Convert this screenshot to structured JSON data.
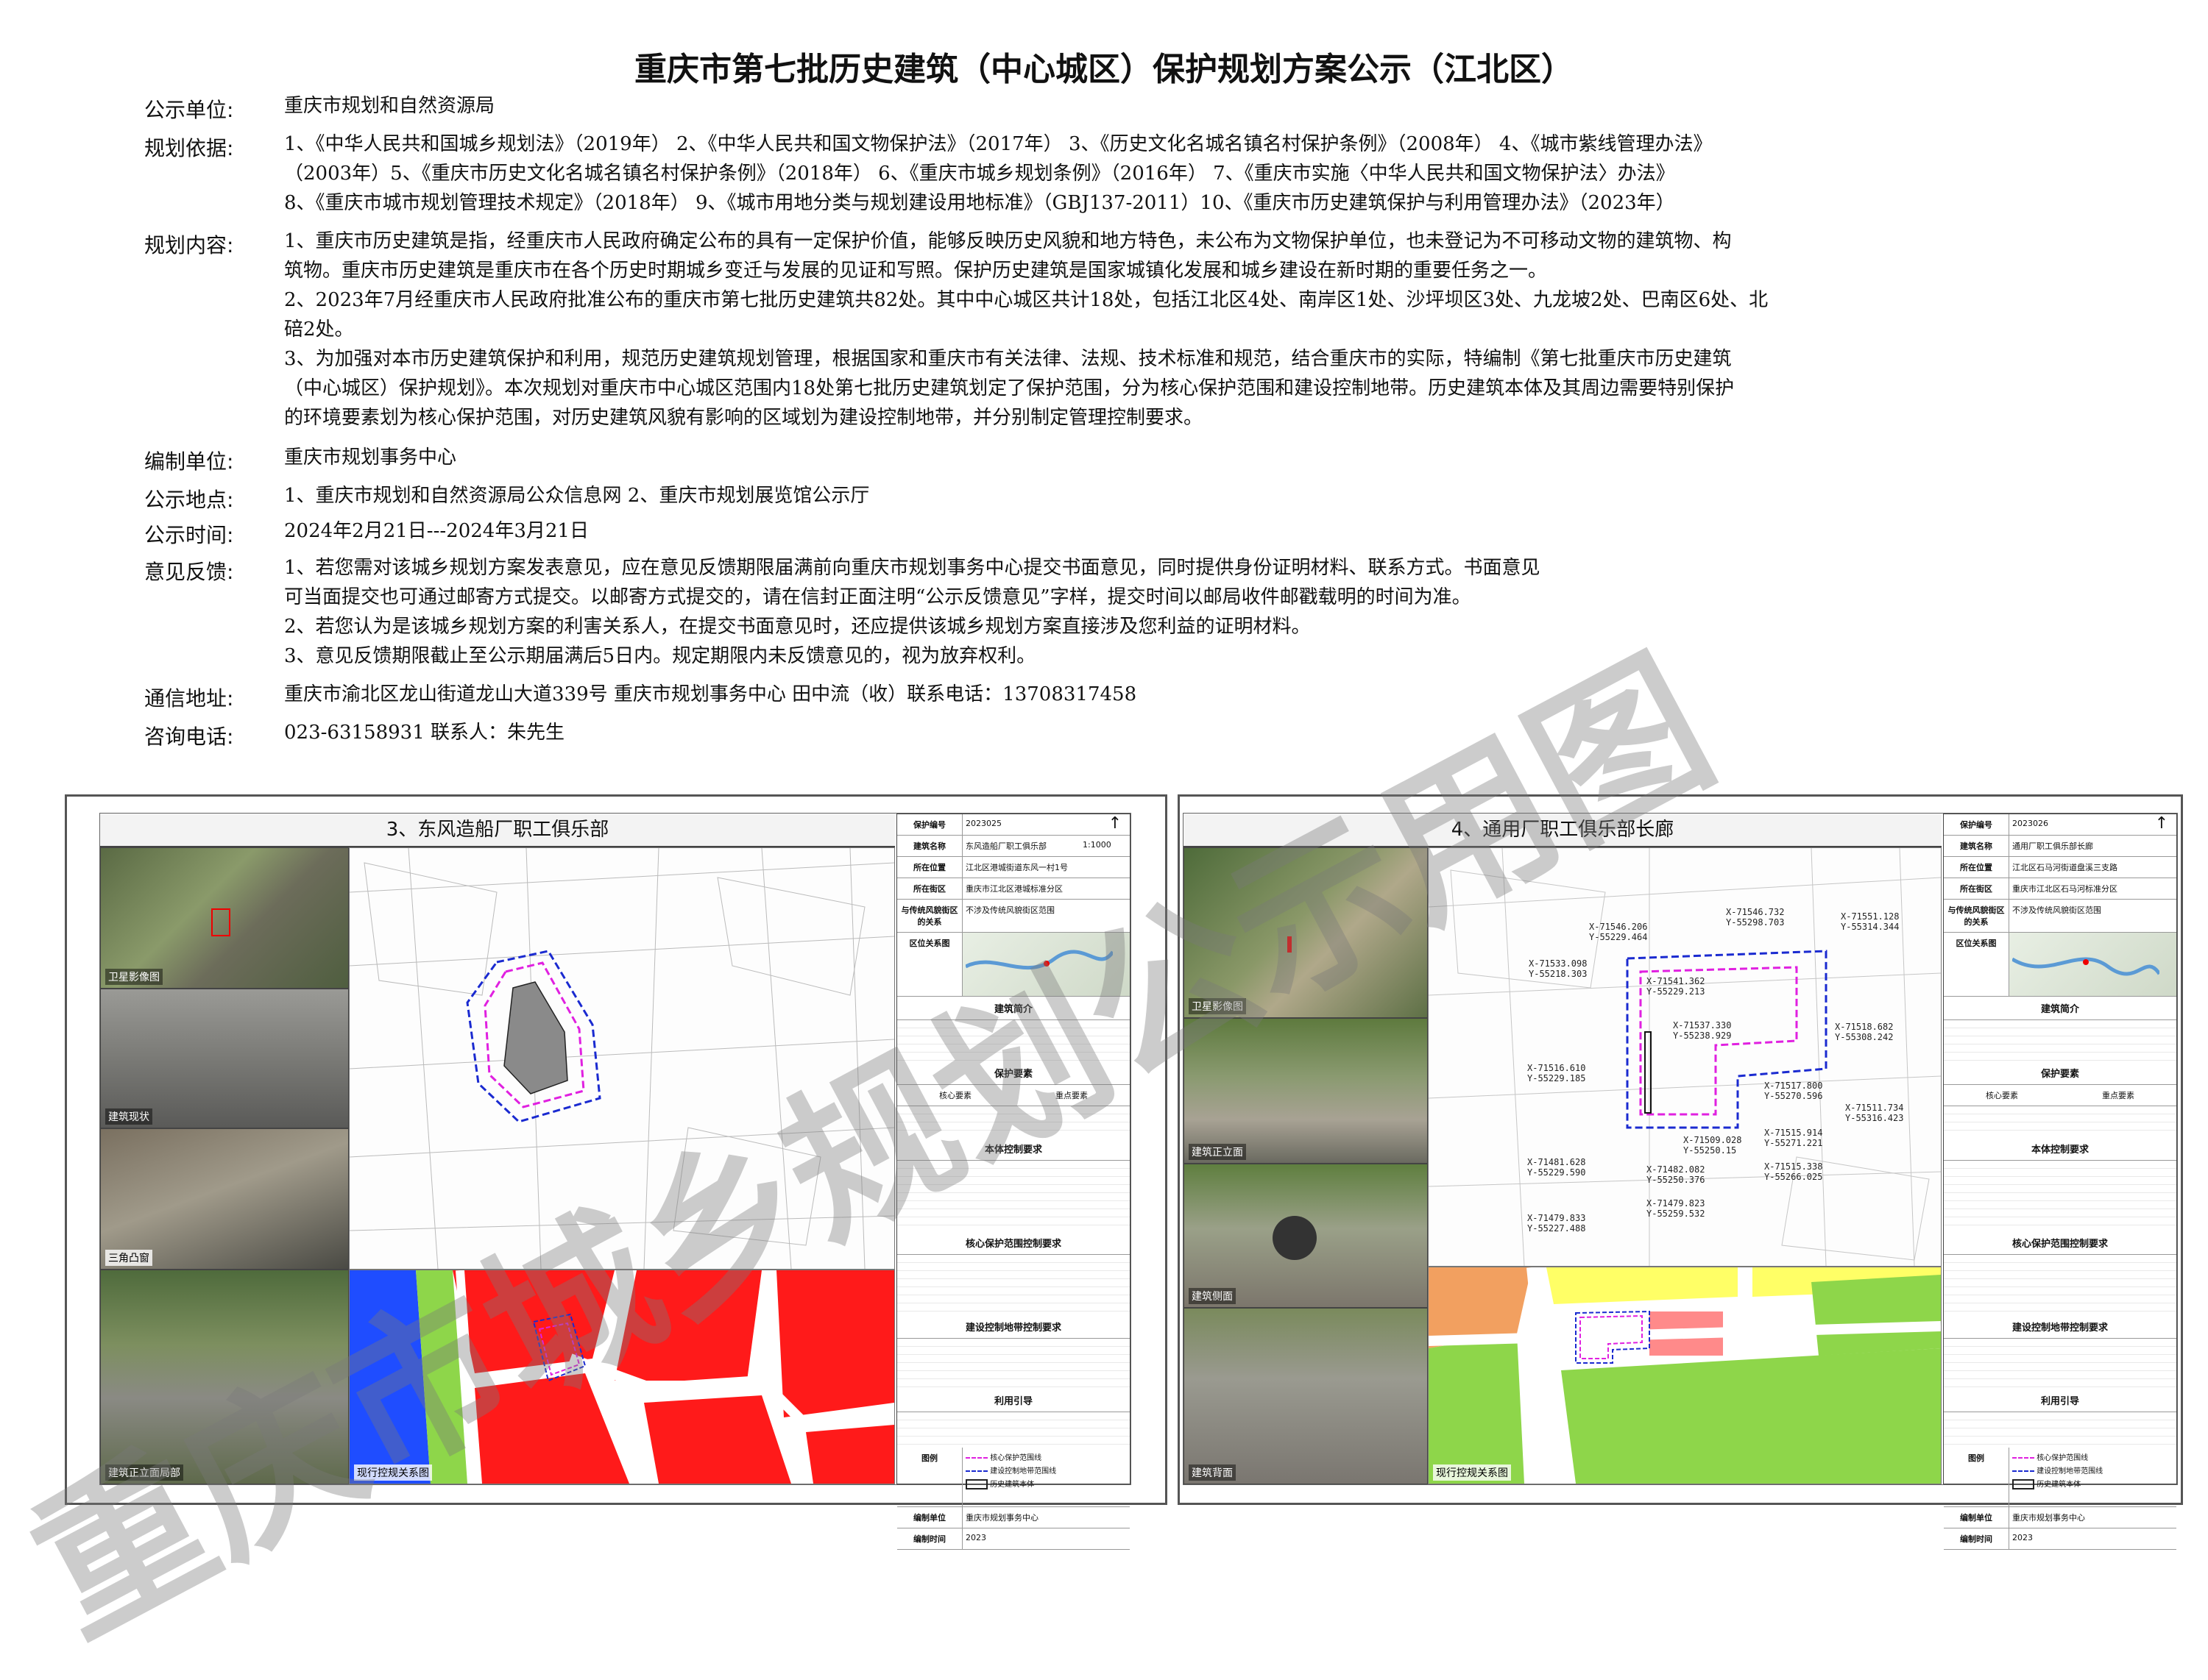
{
  "title": "重庆市第七批历史建筑（中心城区）保护规划方案公示（江北区）",
  "rows": {
    "unit_label": "公示单位:",
    "unit_value": "重庆市规划和自然资源局",
    "basis_label": "规划依据:",
    "basis_lines": [
      "1、《中华人民共和国城乡规划法》（2019年）  2、《中华人民共和国文物保护法》（2017年）  3、《历史文化名城名镇名村保护条例》（2008年）  4、《城市紫线管理办法》",
      "（2003年）5、《重庆市历史文化名城名镇名村保护条例》（2018年）     6、《重庆市城乡规划条例》（2016年）     7、《重庆市实施〈中华人民共和国文物保护法〉办法》",
      "8、《重庆市城市规划管理技术规定》（2018年）     9、《城市用地分类与规划建设用地标准》（GBJ137-2011）10、《重庆市历史建筑保护与利用管理办法》（2023年）"
    ],
    "content_label": "规划内容:",
    "content_lines": [
      "1、重庆市历史建筑是指，经重庆市人民政府确定公布的具有一定保护价值，能够反映历史风貌和地方特色，未公布为文物保护单位，也未登记为不可移动文物的建筑物、构",
      "筑物。重庆市历史建筑是重庆市在各个历史时期城乡变迁与发展的见证和写照。保护历史建筑是国家城镇化发展和城乡建设在新时期的重要任务之一。",
      "2、2023年7月经重庆市人民政府批准公布的重庆市第七批历史建筑共82处。其中中心城区共计18处，包括江北区4处、南岸区1处、沙坪坝区3处、九龙坡2处、巴南区6处、北",
      "碚2处。",
      "3、为加强对本市历史建筑保护和利用，规范历史建筑规划管理，根据国家和重庆市有关法律、法规、技术标准和规范，结合重庆市的实际，特编制《第七批重庆市历史建筑",
      "（中心城区）保护规划》。本次规划对重庆市中心城区范围内18处第七批历史建筑划定了保护范围，分为核心保护范围和建设控制地带。历史建筑本体及其周边需要特别保护",
      "的环境要素划为核心保护范围，对历史建筑风貌有影响的区域划为建设控制地带，并分别制定管理控制要求。"
    ],
    "editor_label": "编制单位:",
    "editor_value": "重庆市规划事务中心",
    "place_label": "公示地点:",
    "place_value": "1、重庆市规划和自然资源局公众信息网     2、重庆市规划展览馆公示厅",
    "time_label": "公示时间:",
    "time_value": "2024年2月21日---2024年3月21日",
    "feedback_label": "意见反馈:",
    "feedback_lines": [
      "1、若您需对该城乡规划方案发表意见，应在意见反馈期限届满前向重庆市规划事务中心提交书面意见，同时提供身份证明材料、联系方式。书面意见",
      "    可当面提交也可通过邮寄方式提交。以邮寄方式提交的，请在信封正面注明“公示反馈意见”字样，提交时间以邮局收件邮戳载明的时间为准。",
      "2、若您认为是该城乡规划方案的利害关系人，在提交书面意见时，还应提供该城乡规划方案直接涉及您利益的证明材料。",
      "3、意见反馈期限截止至公示期届满后5日内。规定期限内未反馈意见的，视为放弃权利。"
    ],
    "address_label": "通信地址:",
    "address_value": "重庆市渝北区龙山街道龙山大道339号  重庆市规划事务中心  田中流（收）联系电话：13708317458",
    "phone_label": "咨询电话:",
    "phone_value": "023-63158931          联系人：朱先生"
  },
  "left_panel": {
    "title": "3、东风造船厂职工俱乐部",
    "captions": [
      "卫星影像图",
      "建筑现状",
      "三角凸窗",
      "建筑正立面局部",
      "现行控规关系图"
    ],
    "table": {
      "row1_k": "保护编号",
      "row1_v": "2023025",
      "row2_k": "建筑名称",
      "row2_v": "东风造船厂职工俱乐部",
      "scale": "1:1000",
      "row3_k": "所在位置",
      "row3_v": "江北区港城街道东风一村1号",
      "row4_k": "所在街区",
      "row4_v": "重庆市江北区港城标准分区",
      "row5_k": "与传统风貌街区的关系",
      "row5_v": "不涉及传统风貌街区范围",
      "loc_k": "区位关系图",
      "intro_h": "建筑简介",
      "elem_h": "保护要素",
      "elem_core": "核心要素",
      "elem_gen": "重点要素",
      "body_h": "本体控制要求",
      "core_h": "核心保护范围控制要求",
      "build_h": "建设控制地带控制要求",
      "use_h": "利用引导",
      "legend_k": "图例",
      "legend_core": "核心保护范围线",
      "legend_build": "建设控制地带范围线",
      "legend_hist": "历史建筑本体",
      "editor_k": "编制单位",
      "editor_v": "重庆市规划事务中心",
      "date_k": "编制时间",
      "date_v": "2023"
    }
  },
  "right_panel": {
    "title": "4、通用厂职工俱乐部长廊",
    "captions": [
      "卫星影像图",
      "建筑正立面",
      "建筑侧面",
      "建筑背面",
      "现行控规关系图"
    ],
    "table": {
      "row1_k": "保护编号",
      "row1_v": "2023026",
      "row2_k": "建筑名称",
      "row2_v": "通用厂职工俱乐部长廊",
      "row3_k": "所在位置",
      "row3_v": "江北区石马河街道盘溪三支路",
      "row4_k": "所在街区",
      "row4_v": "重庆市江北区石马河标准分区",
      "row5_k": "与传统风貌街区的关系",
      "row5_v": "不涉及传统风貌街区范围",
      "loc_k": "区位关系图",
      "intro_h": "建筑简介",
      "elem_h": "保护要素",
      "elem_core": "核心要素",
      "elem_gen": "重点要素",
      "body_h": "本体控制要求",
      "core_h": "核心保护范围控制要求",
      "build_h": "建设控制地带控制要求",
      "use_h": "利用引导",
      "legend_k": "图例",
      "legend_core": "核心保护范围线",
      "legend_build": "建设控制地带范围线",
      "legend_hist": "历史建筑本体",
      "editor_k": "编制单位",
      "editor_v": "重庆市规划事务中心",
      "date_k": "编制时间",
      "date_v": "2023"
    },
    "coords": [
      "X-71546.732\nY-55298.703",
      "X-71546.206\nY-55229.464",
      "X-71551.128\nY-55314.344",
      "X-71533.098\nY-55218.303",
      "X-71541.362\nY-55229.213",
      "X-71537.330\nY-55238.929",
      "X-71518.682\nY-55308.242",
      "X-71516.610\nY-55229.185",
      "X-71517.800\nY-55270.596",
      "X-71509.028\nY-55250.15",
      "X-71515.914\nY-55271.221",
      "X-71511.734\nY-55316.423",
      "X-71482.082\nY-55250.376",
      "X-71515.338\nY-55266.025",
      "X-71481.628\nY-55229.590",
      "X-71479.823\nY-55259.532",
      "X-71479.833\nY-55227.488"
    ]
  },
  "watermark": "重庆市城乡规划公示用图",
  "colors": {
    "core_line": "#e020e0",
    "build_line": "#1a2ad0",
    "land_red": "#ff1a1a",
    "land_blue": "#1f4dff",
    "land_green": "#8ed64a",
    "land_pink": "#ff8a8a"
  }
}
